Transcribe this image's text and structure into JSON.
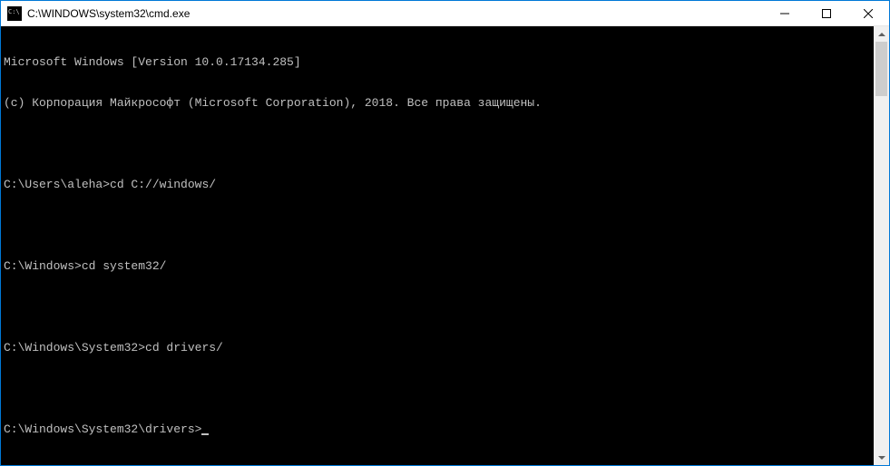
{
  "window": {
    "title": "C:\\WINDOWS\\system32\\cmd.exe"
  },
  "terminal": {
    "banner_line1": "Microsoft Windows [Version 10.0.17134.285]",
    "banner_line2": "(c) Корпорация Майкрософт (Microsoft Corporation), 2018. Все права защищены.",
    "entries": [
      {
        "prompt": "C:\\Users\\aleha>",
        "command": "cd C://windows/"
      },
      {
        "prompt": "C:\\Windows>",
        "command": "cd system32/"
      },
      {
        "prompt": "C:\\Windows\\System32>",
        "command": "cd drivers/"
      }
    ],
    "current_prompt": "C:\\Windows\\System32\\drivers>"
  }
}
